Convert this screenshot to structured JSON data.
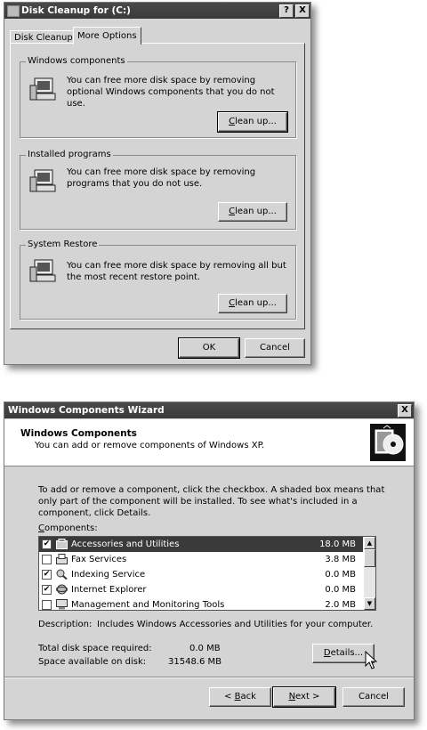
{
  "cleanup": {
    "title": "Disk Cleanup for  (C:)",
    "help_btn": "?",
    "close_btn": "X",
    "tabs": [
      "Disk Cleanup",
      "More Options"
    ],
    "groups": [
      {
        "label": "Windows components",
        "text": "You can free more disk space by removing optional Windows components that you do not use.",
        "btn_pre": "",
        "btn_u": "C",
        "btn_post": "lean up..."
      },
      {
        "label": "Installed programs",
        "text": "You can free more disk space by removing programs that you do not use.",
        "btn_pre": "",
        "btn_u": "C",
        "btn_post": "lean up..."
      },
      {
        "label": "System Restore",
        "text": "You can free more disk space by removing all but the most recent restore point.",
        "btn_pre": "",
        "btn_u": "C",
        "btn_post": "lean up..."
      }
    ],
    "ok_label": "OK",
    "cancel_label": "Cancel"
  },
  "wizard": {
    "title": "Windows Components Wizard",
    "close_btn": "X",
    "header_title": "Windows Components",
    "header_sub": "You can add or remove components of Windows XP.",
    "instructions": "To add or remove a component, click the checkbox.  A shaded box means that only part of the component will be installed.  To see what's included in a component, click Details.",
    "components_label_u": "C",
    "components_label_rest": "omponents:",
    "components": [
      {
        "name": "Accessories and Utilities",
        "size": "18.0 MB",
        "checked": true,
        "selected": true,
        "icon": "accessories-icon"
      },
      {
        "name": "Fax Services",
        "size": "3.8 MB",
        "checked": false,
        "selected": false,
        "icon": "fax-icon"
      },
      {
        "name": "Indexing Service",
        "size": "0.0 MB",
        "checked": true,
        "selected": false,
        "icon": "indexing-icon"
      },
      {
        "name": "Internet Explorer",
        "size": "0.0 MB",
        "checked": true,
        "selected": false,
        "icon": "internet-explorer-icon"
      },
      {
        "name": "Management and Monitoring Tools",
        "size": "2.0 MB",
        "checked": false,
        "selected": false,
        "icon": "management-tools-icon"
      }
    ],
    "description_label": "Description:",
    "description_text": "Includes Windows Accessories and Utilities for your computer.",
    "total_label": "Total disk space required:",
    "total_value": "0.0 MB",
    "avail_label": "Space available on disk:",
    "avail_value": "31548.6 MB",
    "details_pre": "",
    "details_u": "D",
    "details_post": "etails...",
    "back_pre": "< ",
    "back_u": "B",
    "back_post": "ack",
    "next_pre": "",
    "next_u": "N",
    "next_post": "ext >",
    "cancel_label": "Cancel"
  }
}
